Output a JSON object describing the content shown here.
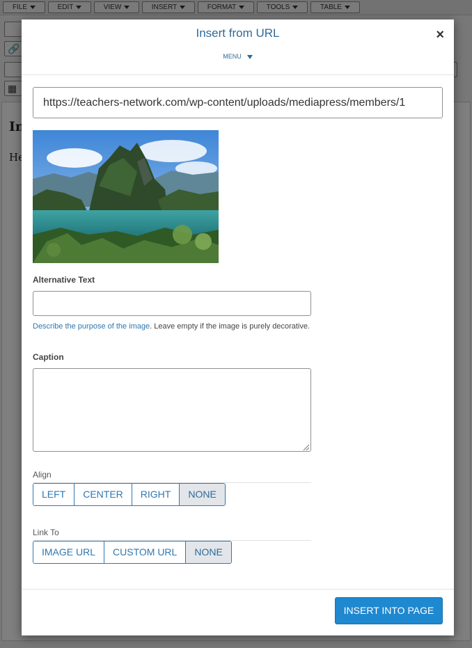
{
  "editor": {
    "menu": [
      {
        "label": "File"
      },
      {
        "label": "Edit"
      },
      {
        "label": "View"
      },
      {
        "label": "Insert"
      },
      {
        "label": "Format"
      },
      {
        "label": "Tools"
      },
      {
        "label": "Table"
      }
    ],
    "heading_fragment": "In",
    "paragraph_fragment": "He"
  },
  "dialog": {
    "title": "Insert from URL",
    "close_glyph": "×",
    "menu_label": "MENU",
    "url_value": "https://teachers-network.com/wp-content/uploads/mediapress/members/1",
    "preview_alt": "Preview of a tropical lagoon with limestone karst islands",
    "alt_text": {
      "label": "Alternative Text",
      "value": "",
      "help_link": "Describe the purpose of the image",
      "help_rest": ". Leave empty if the image is purely decorative."
    },
    "caption": {
      "label": "Caption",
      "value": ""
    },
    "align": {
      "label": "Align",
      "options": [
        "Left",
        "Center",
        "Right",
        "None"
      ],
      "selected": "None"
    },
    "link_to": {
      "label": "Link To",
      "options": [
        "Image URL",
        "Custom URL",
        "None"
      ],
      "selected": "None"
    },
    "submit_label": "Insert into page"
  },
  "colors": {
    "accent": "#2f77b0",
    "primary_button": "#1e88d0",
    "title": "#2f6a98"
  }
}
